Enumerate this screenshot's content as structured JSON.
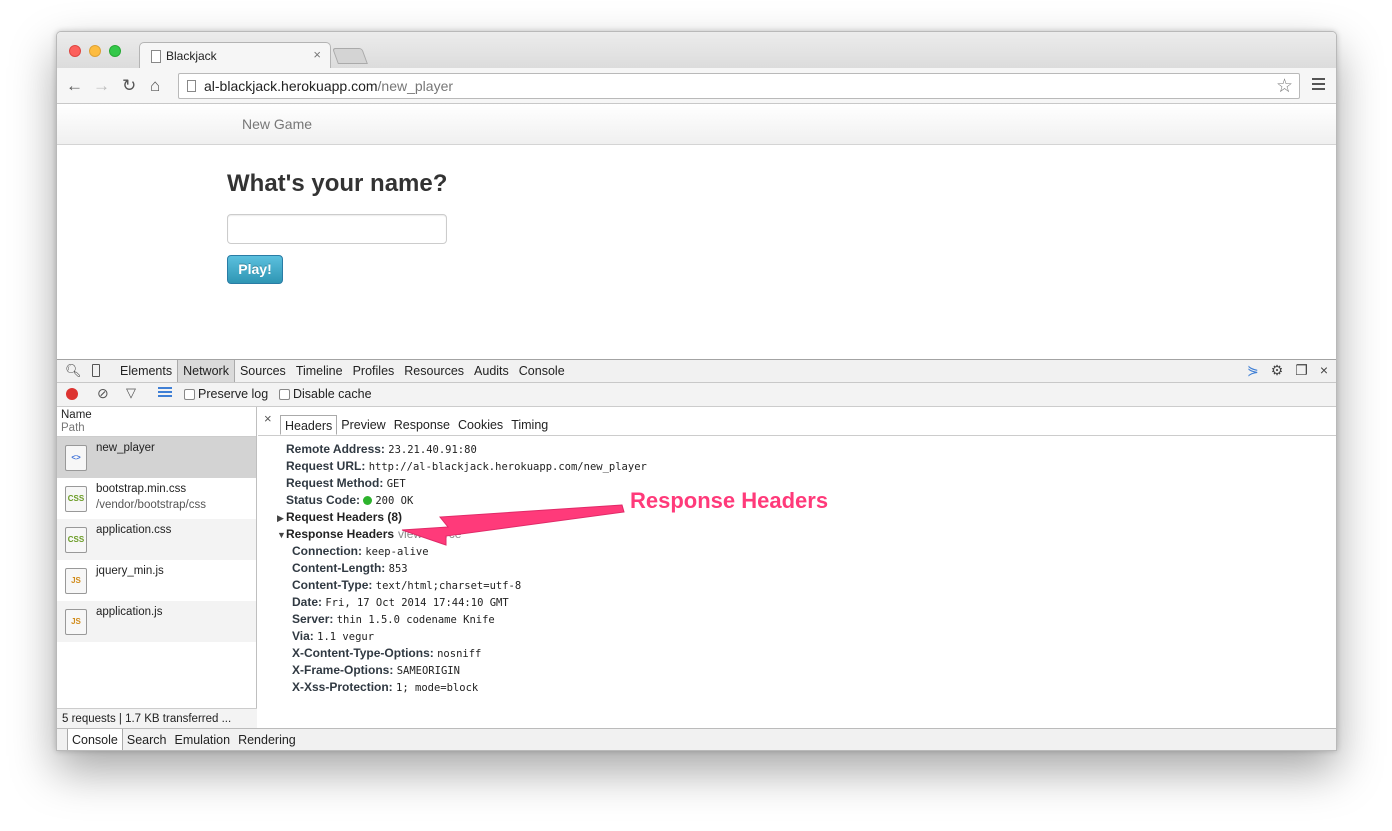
{
  "browser": {
    "tab_title": "Blackjack",
    "tab_close": "×",
    "url_host": "al-blackjack.herokuapp.com",
    "url_path": "/new_player",
    "nav_back": "←",
    "nav_forward": "→",
    "nav_reload": "↻",
    "nav_home": "⌂",
    "star": "☆"
  },
  "page": {
    "nav_link": "New Game",
    "heading": "What's your name?",
    "name_input_value": "",
    "play_button": "Play!"
  },
  "devtools": {
    "tabs": [
      "Elements",
      "Network",
      "Sources",
      "Timeline",
      "Profiles",
      "Resources",
      "Audits",
      "Console"
    ],
    "active_tab": "Network",
    "preserve_log": "Preserve log",
    "disable_cache": "Disable cache",
    "list_header": {
      "name": "Name",
      "path": "Path"
    },
    "requests": [
      {
        "name": "new_player",
        "path": "",
        "type": "<>"
      },
      {
        "name": "bootstrap.min.css",
        "path": "/vendor/bootstrap/css",
        "type": "CSS"
      },
      {
        "name": "application.css",
        "path": "",
        "type": "CSS"
      },
      {
        "name": "jquery_min.js",
        "path": "",
        "type": "JS"
      },
      {
        "name": "application.js",
        "path": "",
        "type": "JS"
      }
    ],
    "status_bar": "5 requests | 1.7 KB transferred ...",
    "detail_tabs": [
      "Headers",
      "Preview",
      "Response",
      "Cookies",
      "Timing"
    ],
    "general": [
      {
        "key": "Remote Address:",
        "value": "23.21.40.91:80"
      },
      {
        "key": "Request URL:",
        "value": "http://al-blackjack.herokuapp.com/new_player"
      },
      {
        "key": "Request Method:",
        "value": "GET"
      },
      {
        "key": "Status Code:",
        "value": "200 OK"
      }
    ],
    "request_headers_label": "Request Headers (8)",
    "response_headers_label": "Response Headers",
    "view_source": "view source",
    "response_headers": [
      {
        "key": "Connection:",
        "value": "keep-alive"
      },
      {
        "key": "Content-Length:",
        "value": "853"
      },
      {
        "key": "Content-Type:",
        "value": "text/html;charset=utf-8"
      },
      {
        "key": "Date:",
        "value": "Fri, 17 Oct 2014 17:44:10 GMT"
      },
      {
        "key": "Server:",
        "value": "thin 1.5.0 codename Knife"
      },
      {
        "key": "Via:",
        "value": "1.1 vegur"
      },
      {
        "key": "X-Content-Type-Options:",
        "value": "nosniff"
      },
      {
        "key": "X-Frame-Options:",
        "value": "SAMEORIGIN"
      },
      {
        "key": "X-Xss-Protection:",
        "value": "1; mode=block"
      }
    ],
    "drawer_tabs": [
      "Console",
      "Search",
      "Emulation",
      "Rendering"
    ]
  },
  "annotation": {
    "text": "Response Headers",
    "color": "#ff3a7a"
  },
  "colors": {
    "record": "#dd3431",
    "status_ok": "#2db32d",
    "play_button": "#2f96b4"
  }
}
